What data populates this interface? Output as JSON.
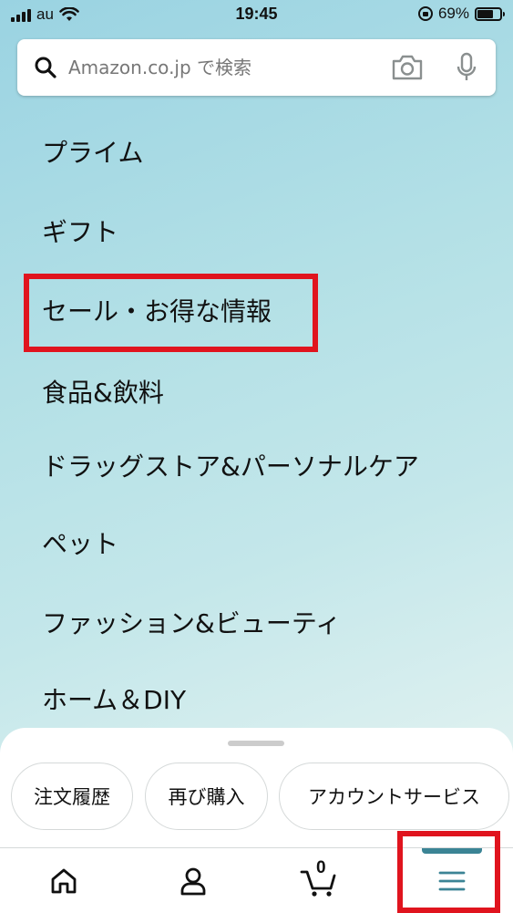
{
  "status_bar": {
    "carrier": "au",
    "time": "19:45",
    "battery": "69%",
    "battery_level": 0.69
  },
  "search": {
    "placeholder": "Amazon.co.jp で検索"
  },
  "menu": {
    "items": [
      {
        "label": "プライム"
      },
      {
        "label": "ギフト"
      },
      {
        "label": "セール・お得な情報"
      },
      {
        "label": "食品&飲料"
      },
      {
        "label": "ドラッグストア&パーソナルケア"
      },
      {
        "label": "ペット"
      },
      {
        "label": "ファッション&ビューティ"
      },
      {
        "label": "ホーム＆DIY"
      }
    ]
  },
  "shortcuts": {
    "chips": [
      {
        "label": "注文履歴"
      },
      {
        "label": "再び購入"
      },
      {
        "label": "アカウントサービス"
      }
    ]
  },
  "tab_bar": {
    "cart_count": "0",
    "items": [
      {
        "icon": "home-icon"
      },
      {
        "icon": "user-icon"
      },
      {
        "icon": "cart-icon"
      },
      {
        "icon": "menu-icon"
      }
    ]
  },
  "colors": {
    "accent": "#3b8495",
    "highlight": "#e0141e"
  }
}
